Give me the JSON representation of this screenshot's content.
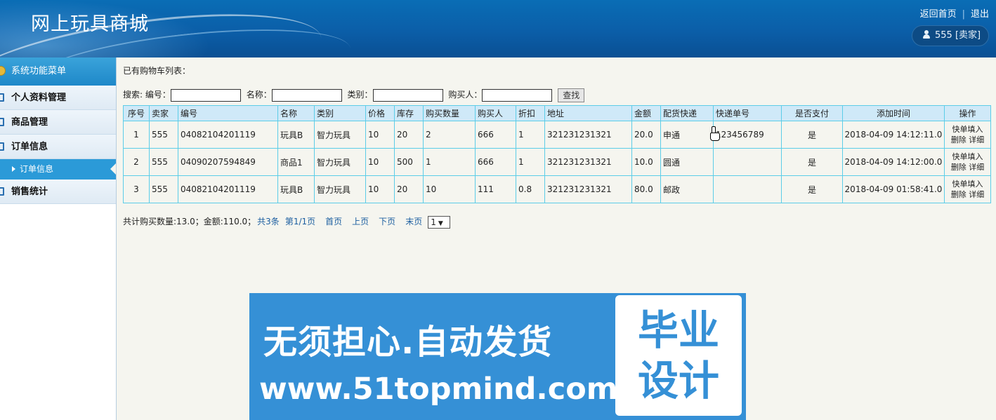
{
  "header": {
    "title": "网上玩具商城",
    "link_home": "返回首页",
    "link_logout": "退出",
    "link_separator": "|",
    "user": "555 [卖家]"
  },
  "sidebar": {
    "heading": "系统功能菜单",
    "items": [
      {
        "label": "个人资料管理"
      },
      {
        "label": "商品管理"
      },
      {
        "label": "订单信息"
      },
      {
        "label": "订单信息"
      },
      {
        "label": "销售统计"
      }
    ]
  },
  "main": {
    "list_title": "已有购物车列表：",
    "search": {
      "prefix": "搜索: 编号：",
      "name_label": "名称：",
      "category_label": "类别：",
      "buyer_label": "购买人：",
      "button": "查找"
    },
    "table": {
      "columns": [
        "序号",
        "卖家",
        "编号",
        "名称",
        "类别",
        "价格",
        "库存",
        "购买数量",
        "购买人",
        "折扣",
        "地址",
        "金额",
        "配货快递",
        "快递单号",
        "是否支付",
        "添加时间",
        "操作"
      ],
      "rows": [
        [
          "1",
          "555",
          "04082104201119",
          "玩具B",
          "智力玩具",
          "10",
          "20",
          "2",
          "666",
          "1",
          "321231231321",
          "20.0",
          "申通",
          "123456789",
          "是",
          "2018-04-09 14:12:11.0"
        ],
        [
          "2",
          "555",
          "04090207594849",
          "商品1",
          "智力玩具",
          "10",
          "500",
          "1",
          "666",
          "1",
          "321231231321",
          "10.0",
          "圆通",
          "",
          "是",
          "2018-04-09 14:12:00.0"
        ],
        [
          "3",
          "555",
          "04082104201119",
          "玩具B",
          "智力玩具",
          "10",
          "20",
          "10",
          "111",
          "0.8",
          "321231231321",
          "80.0",
          "邮政",
          "",
          "是",
          "2018-04-09 01:58:41.0"
        ]
      ],
      "ops": {
        "fill": "快单填入",
        "delete": "删除",
        "detail": "详细"
      }
    },
    "pager": {
      "summary": "共计购买数量:13.0；金额:110.0；",
      "total": "共3条",
      "page_info": "第1/1页",
      "first": "首页",
      "prev": "上页",
      "next": "下页",
      "last": "末页",
      "page_select": "1"
    }
  },
  "watermark": {
    "line1": "无须担心.自动发货",
    "line2": "www.51topmind.com",
    "badge_line1": "毕业",
    "badge_line2": "设计"
  }
}
